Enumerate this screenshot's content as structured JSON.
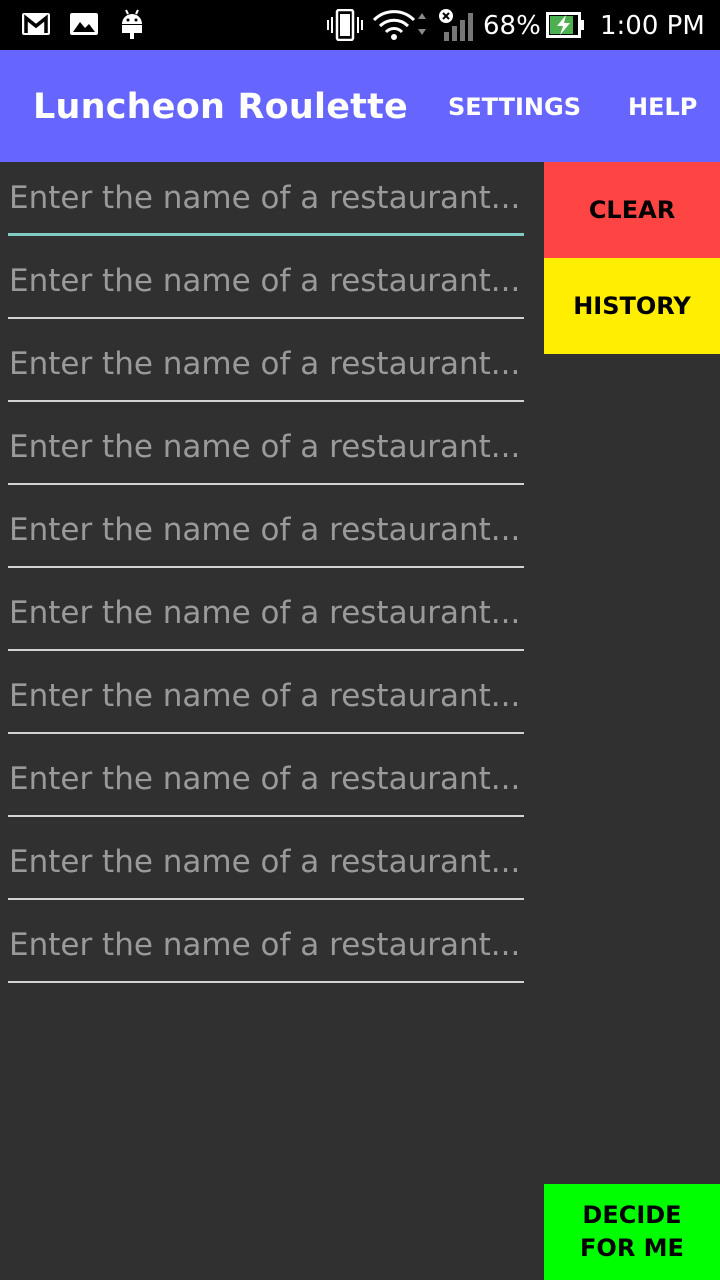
{
  "status_bar": {
    "battery_percent": "68%",
    "time": "1:00 PM",
    "icons": [
      "gmail-icon",
      "photos-icon",
      "android-debug-icon",
      "vibrate-icon",
      "wifi-icon",
      "signal-icon",
      "battery-charging-icon"
    ]
  },
  "app_bar": {
    "title": "Luncheon Roulette",
    "settings_label": "SETTINGS",
    "help_label": "HELP"
  },
  "restaurant_inputs": [
    {
      "value": "",
      "placeholder": "Enter the name of a restaurant..."
    },
    {
      "value": "",
      "placeholder": "Enter the name of a restaurant..."
    },
    {
      "value": "",
      "placeholder": "Enter the name of a restaurant..."
    },
    {
      "value": "",
      "placeholder": "Enter the name of a restaurant..."
    },
    {
      "value": "",
      "placeholder": "Enter the name of a restaurant..."
    },
    {
      "value": "",
      "placeholder": "Enter the name of a restaurant..."
    },
    {
      "value": "",
      "placeholder": "Enter the name of a restaurant..."
    },
    {
      "value": "",
      "placeholder": "Enter the name of a restaurant..."
    },
    {
      "value": "",
      "placeholder": "Enter the name of a restaurant..."
    },
    {
      "value": "",
      "placeholder": "Enter the name of a restaurant..."
    }
  ],
  "buttons": {
    "clear_label": "CLEAR",
    "history_label": "HISTORY",
    "decide_line1": "DECIDE",
    "decide_line2": "FOR ME"
  },
  "colors": {
    "app_bar": "#6666ff",
    "background": "#303030",
    "clear": "#ff4444",
    "history": "#ffee00",
    "decide": "#00ff00",
    "focus_underline": "#80cbc4"
  }
}
